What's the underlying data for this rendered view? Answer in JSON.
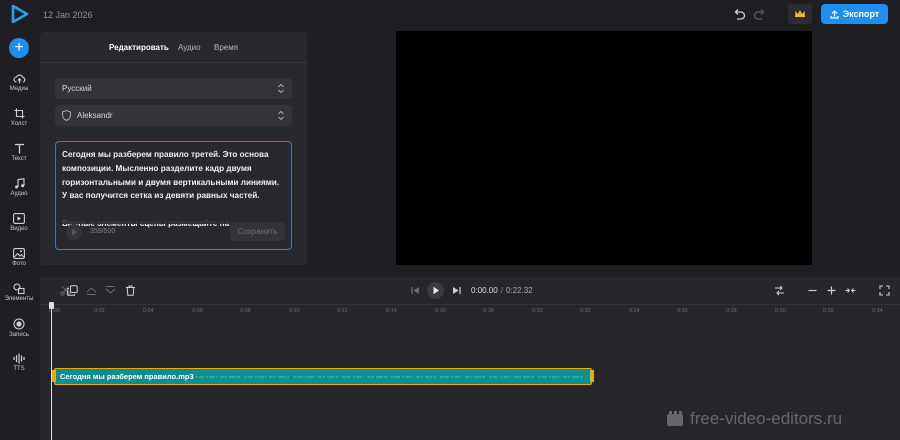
{
  "header": {
    "date": "12 Jan 2026",
    "export_label": "Экспорт"
  },
  "sidebar": {
    "items": [
      {
        "label": "Медиа"
      },
      {
        "label": "Холст"
      },
      {
        "label": "Текст"
      },
      {
        "label": "Аудио"
      },
      {
        "label": "Видео"
      },
      {
        "label": "Фото"
      },
      {
        "label": "Элементы"
      },
      {
        "label": "Запись"
      },
      {
        "label": "TTS"
      }
    ]
  },
  "panel": {
    "tabs": [
      {
        "label": "Редактировать",
        "active": true
      },
      {
        "label": "Аудио"
      },
      {
        "label": "Время"
      }
    ],
    "language": "Русский",
    "voice": "Aleksandr",
    "text": "Сегодня мы разберем правило третей. Это основа композиции. Мысленно разделите кадр двумя горизонтальными и двумя вертикальными линиями. У вас получится сетка из девяти равных частей.\n\nВажные элементы сцены размещайте на",
    "counter": "359/500",
    "save_label": "Сохранить"
  },
  "timeline": {
    "current_time": "0:00.00",
    "separator": "/",
    "total_time": "0:22.32",
    "ticks": [
      "0:00",
      "0:02",
      "0:04",
      "0:06",
      "0:08",
      "0:10",
      "0:12",
      "0:14",
      "0:16",
      "0:18",
      "0:20",
      "0:22",
      "0:24",
      "0:26",
      "0:28",
      "0:30",
      "0:32",
      "0:34"
    ],
    "clip": {
      "name": "Сегодня мы разберем правило.mp3"
    }
  },
  "watermark": {
    "text": "free-video-editors.ru"
  },
  "colors": {
    "accent": "#1f8ef1",
    "clip": "#0e8f8f",
    "clip_border": "#e6a91a",
    "background": "#1f1f23",
    "panel": "#28282d"
  }
}
